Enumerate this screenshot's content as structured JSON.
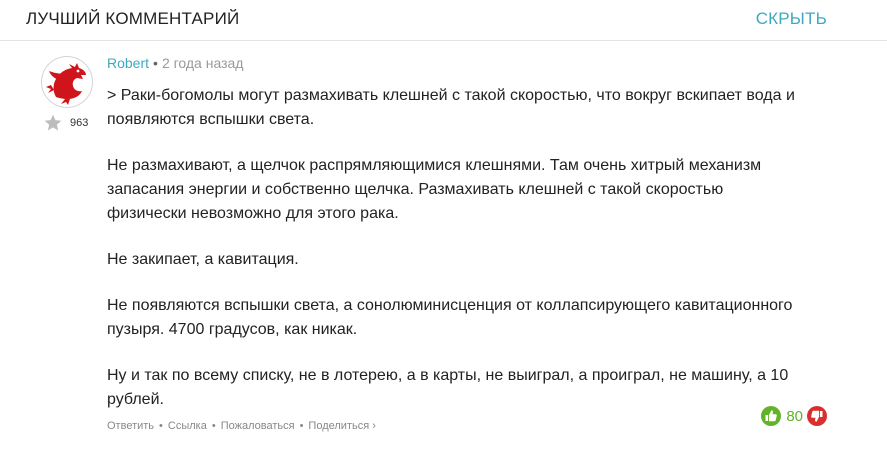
{
  "header": {
    "title": "ЛУЧШИЙ КОММЕНТАРИЙ",
    "hide_label": "СКРЫТЬ"
  },
  "comment": {
    "author": "Robert",
    "separator": "•",
    "time": "2 года назад",
    "user_rating": "963",
    "paragraphs": [
      "> Раки-богомолы могут размахивать клешней с такой скоростью, что вокруг вскипает вода и появляются вспышки света.",
      "Не размахивают, а щелчок распрямляющимися клешнями. Там очень хитрый механизм запасания энергии и собственно щелчка. Размахивать клешней с такой скоростью физически невозможно для этого рака.",
      "Не закипает, а кавитация.",
      "Не появляются вспышки света, а сонолюминисценция от коллапсирующего кавитационного пузыря. 4700 градусов, как никак.",
      "Ну и так по всему списку, не в лотерею, а в карты, не выиграл, а проиграл, не машину, а 10 рублей."
    ],
    "actions": {
      "reply": "Ответить",
      "link": "Ссылка",
      "report": "Пожаловаться",
      "share": "Поделиться ›",
      "separator": "•"
    },
    "score": "80"
  },
  "colors": {
    "accent": "#3fa9c0",
    "upvote": "#62b22a",
    "downvote": "#d9302f",
    "avatar_dragon": "#d0141b",
    "star": "#bdbdbd"
  },
  "icons": {
    "avatar": "red-dragon-avatar",
    "rating": "star-icon",
    "upvote": "thumbs-up-icon",
    "downvote": "thumbs-down-icon"
  }
}
